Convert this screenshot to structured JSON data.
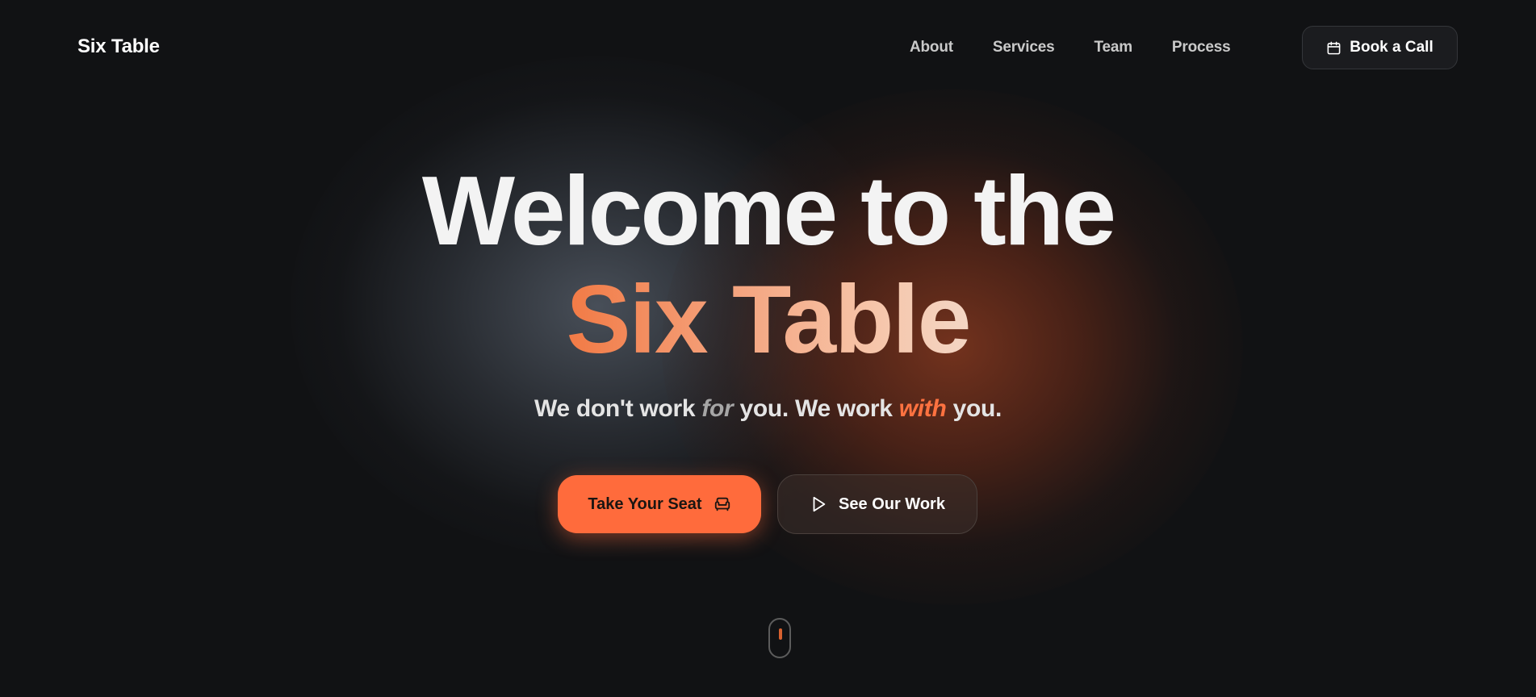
{
  "header": {
    "logo": "Six Table",
    "nav": [
      "About",
      "Services",
      "Team",
      "Process"
    ],
    "book_button": {
      "label": "Book a Call",
      "icon": "calendar-icon"
    }
  },
  "hero": {
    "title_line1": "Welcome to the",
    "title_line2": "Six Table",
    "tagline": {
      "part1": "We don't work ",
      "emph1": "for",
      "part2": " you. We work ",
      "emph2": "with",
      "part3": " you."
    },
    "primary_cta": {
      "label": "Take Your Seat",
      "icon": "armchair-icon"
    },
    "secondary_cta": {
      "label": "See Our Work",
      "icon": "play-icon"
    }
  },
  "scroll_indicator": {
    "icon": "mouse-scroll-icon"
  },
  "colors": {
    "background": "#111214",
    "accent": "#ff6b3c",
    "text": "#f3f3f3",
    "muted": "#c9c9c9"
  }
}
